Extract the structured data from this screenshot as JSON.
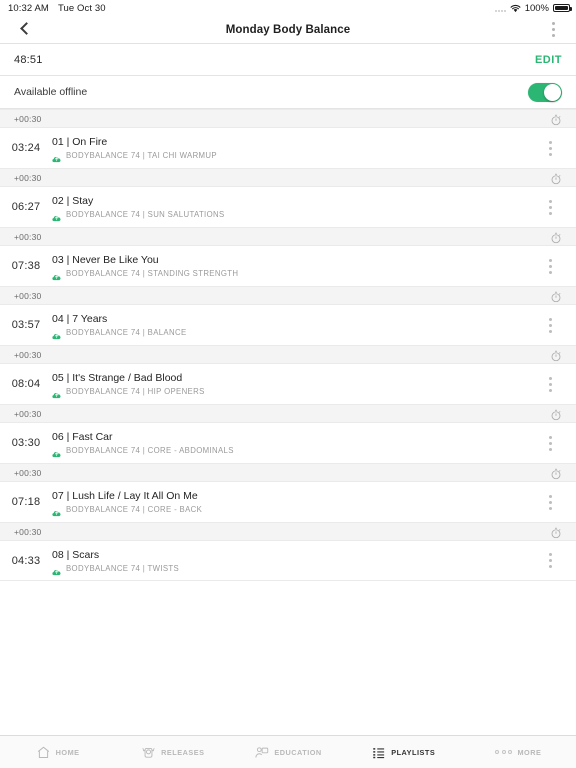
{
  "status_bar": {
    "time": "10:32 AM",
    "date": "Tue Oct 30",
    "battery_percent": "100%",
    "wifi_icon": "wifi-icon",
    "battery_icon": "battery-full-icon",
    "signal_icon": "signal-dots-icon"
  },
  "nav": {
    "back_icon": "chevron-left-icon",
    "title": "Monday Body Balance",
    "more_icon": "overflow-menu-icon"
  },
  "header": {
    "total_duration": "48:51",
    "edit_label": "EDIT",
    "offline_label": "Available offline",
    "offline_enabled": true
  },
  "theme": {
    "accent": "#2bb673",
    "cloud_green": "#2bb673",
    "gap_row_bg": "#f4f4f4",
    "text_primary": "#242424",
    "text_muted": "#9a9a9a"
  },
  "gap": {
    "label": "+00:30",
    "icon": "stopwatch-icon"
  },
  "tracks": [
    {
      "time": "03:24",
      "title": "01 | On Fire",
      "meta": "BODYBALANCE 74 | TAI CHI WARMUP",
      "downloaded": true,
      "gap_before": "+00:30"
    },
    {
      "time": "06:27",
      "title": "02 | Stay",
      "meta": "BODYBALANCE 74 | SUN SALUTATIONS",
      "downloaded": true,
      "gap_before": "+00:30"
    },
    {
      "time": "07:38",
      "title": "03 | Never Be Like You",
      "meta": "BODYBALANCE 74 | STANDING STRENGTH",
      "downloaded": true,
      "gap_before": "+00:30"
    },
    {
      "time": "03:57",
      "title": "04 | 7 Years",
      "meta": "BODYBALANCE 74 | BALANCE",
      "downloaded": true,
      "gap_before": "+00:30"
    },
    {
      "time": "08:04",
      "title": "05 | It's Strange / Bad Blood",
      "meta": "BODYBALANCE 74 | HIP OPENERS",
      "downloaded": true,
      "gap_before": "+00:30"
    },
    {
      "time": "03:30",
      "title": "06 | Fast Car",
      "meta": "BODYBALANCE 74 | CORE - ABDOMINALS",
      "downloaded": true,
      "gap_before": "+00:30"
    },
    {
      "time": "07:18",
      "title": "07 | Lush Life / Lay It All On Me",
      "meta": "BODYBALANCE 74 | CORE - BACK",
      "downloaded": true,
      "gap_before": "+00:30"
    },
    {
      "time": "04:33",
      "title": "08 | Scars",
      "meta": "BODYBALANCE 74 | TWISTS",
      "downloaded": true,
      "gap_before": "+00:30"
    }
  ],
  "tabbar": {
    "active": "PLAYLISTS",
    "items": [
      {
        "label": "HOME",
        "icon": "home-icon"
      },
      {
        "label": "RELEASES",
        "icon": "barbell-icon"
      },
      {
        "label": "EDUCATION",
        "icon": "person-screen-icon"
      },
      {
        "label": "PLAYLISTS",
        "icon": "playlist-icon"
      },
      {
        "label": "MORE",
        "icon": "more-dots-icon"
      }
    ]
  }
}
